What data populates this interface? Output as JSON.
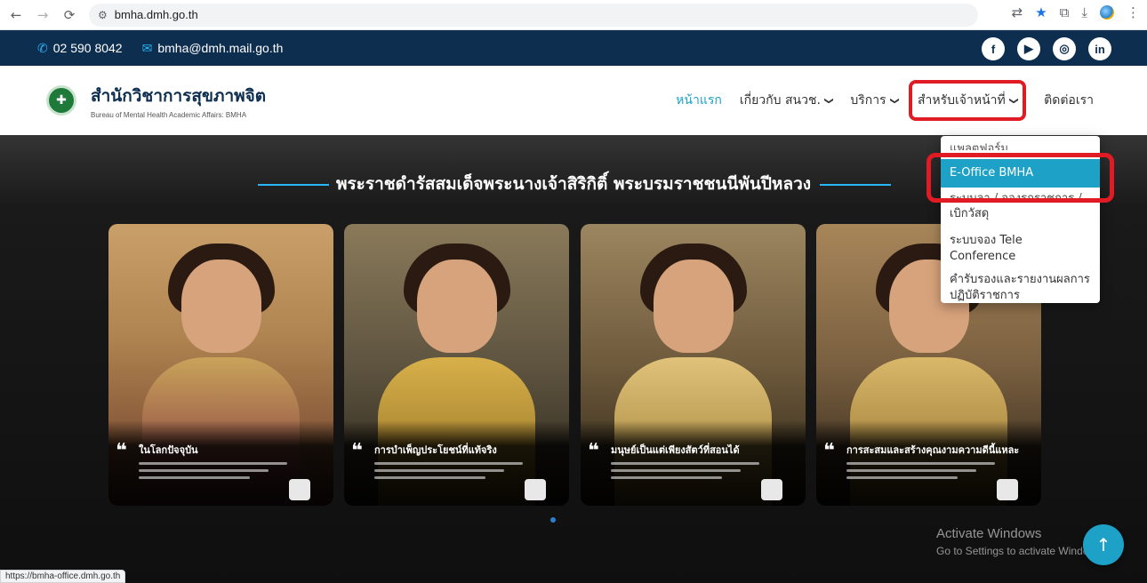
{
  "browser": {
    "url": "bmha.dmh.go.th",
    "status_url": "https://bmha-office.dmh.go.th",
    "icons": [
      "back-icon",
      "forward-icon",
      "reload-icon",
      "site-info-icon",
      "translate-icon",
      "star-icon",
      "extensions-icon",
      "download-icon",
      "profile-icon",
      "more-icon"
    ]
  },
  "topbar": {
    "phone": "02 590 8042",
    "email": "bmha@dmh.mail.go.th",
    "socials": [
      "f",
      "▶",
      "◎",
      "in"
    ]
  },
  "header": {
    "brand_th": "สำนักวิชาการสุขภาพจิต",
    "brand_en": "Bureau of Mental Health Academic Affairs: BMHA",
    "menu": {
      "home": "หน้าแรก",
      "about": "เกี่ยวกับ สนวช.",
      "services": "บริการ",
      "staff": "สำหรับเจ้าหน้าที่",
      "contact": "ติดต่อเรา"
    }
  },
  "main": {
    "headline": "พระราชดำรัสสมเด็จพระนางเจ้าสิริกิติ์ พระบรมราชชนนีพันปีหลวง",
    "cards": [
      {
        "title": "ในโลกปัจจุบัน"
      },
      {
        "title": "การบำเพ็ญประโยชน์ที่แท้จริง"
      },
      {
        "title": "มนุษย์เป็นแต่เพียงสัตว์ที่สอนได้"
      },
      {
        "title": "การสะสมและสร้างคุณงามความดีนี้แหละ"
      }
    ]
  },
  "dropdown": {
    "items": [
      "แพลตฟอร์ม",
      "E-Office BMHA",
      "ระบบลา / จองรถราชการ / เบิกวัสดุ",
      "ระบบจอง Tele Conference",
      "คำรับรองและรายงานผลการปฏิบัติราชการ"
    ],
    "visible_partial_1": "แพลตฟอร์ม",
    "visible_partial_3a": "ระบบลา / จองรถราชการ /",
    "visible_partial_3b": "เบิกวัสดุ"
  },
  "watermark": {
    "line1": "Activate Windows",
    "line2": "Go to Settings to activate Windows."
  },
  "colors": {
    "topbar": "#0e2e4f",
    "accent": "#1da1c7",
    "highlight": "#e01b24"
  }
}
